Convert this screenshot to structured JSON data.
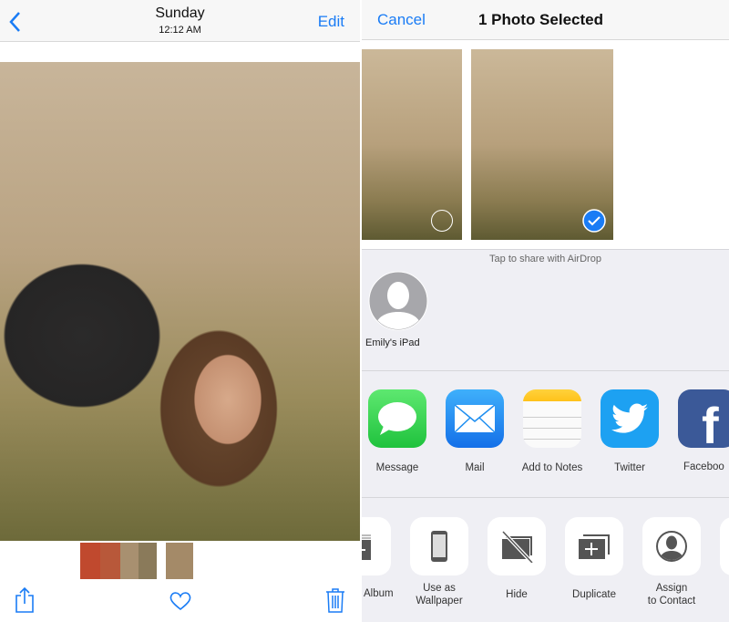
{
  "viewer": {
    "title": "Sunday",
    "subtitle": "12:12 AM",
    "edit": "Edit"
  },
  "share": {
    "cancel": "Cancel",
    "title": "1 Photo Selected",
    "airdrop_hint": "Tap to share with AirDrop",
    "airdrop_device": "Emily's iPad",
    "apps": [
      {
        "label": "Message",
        "color": "#34c759"
      },
      {
        "label": "Mail",
        "color": "#1e8ef0"
      },
      {
        "label": "Add to Notes",
        "color": "#ffd23c"
      },
      {
        "label": "Twitter",
        "color": "#1da1f2"
      },
      {
        "label": "Faceboo",
        "color": "#3b5998"
      }
    ],
    "actions": [
      {
        "label": "Album"
      },
      {
        "label": "Use as Wallpaper",
        "l1": "Use as",
        "l2": "Wallpaper"
      },
      {
        "label": "Hide"
      },
      {
        "label": "Duplicate"
      },
      {
        "label": "Assign to Contact",
        "l1": "Assign",
        "l2": "to Contact"
      }
    ],
    "accent": "#1a7cf5"
  }
}
